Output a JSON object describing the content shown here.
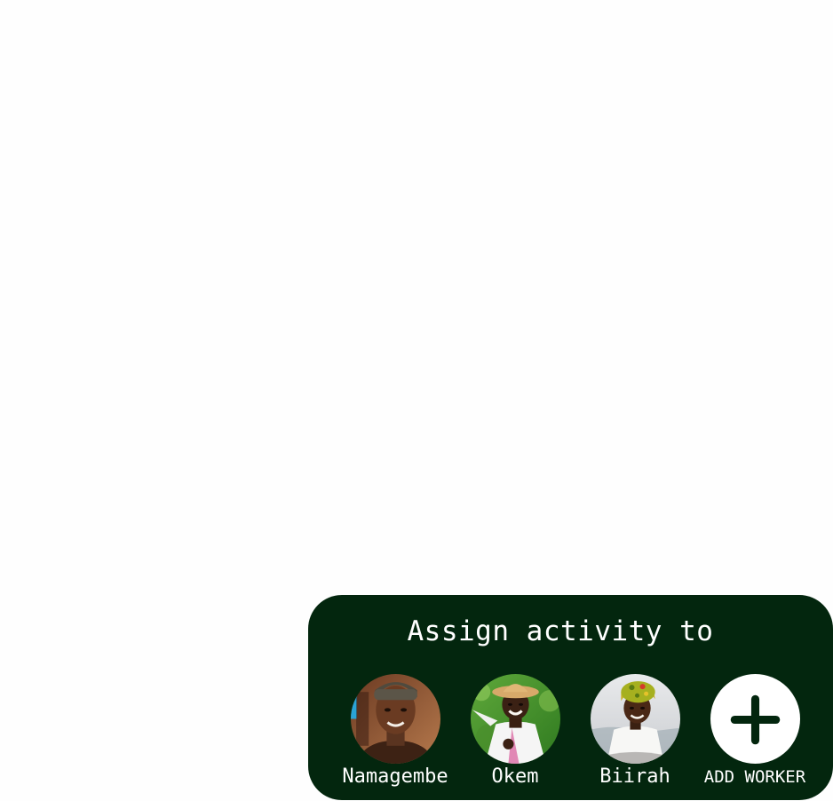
{
  "panel": {
    "title": "Assign activity to",
    "background_color": "#03260e"
  },
  "workers": [
    {
      "name": "Namagembe",
      "avatar_icon": "person-photo-avatar"
    },
    {
      "name": "Okem",
      "avatar_icon": "person-photo-avatar"
    },
    {
      "name": "Biirah",
      "avatar_icon": "person-photo-avatar"
    }
  ],
  "add_worker": {
    "label": "ADD WORKER",
    "icon": "plus-icon"
  }
}
